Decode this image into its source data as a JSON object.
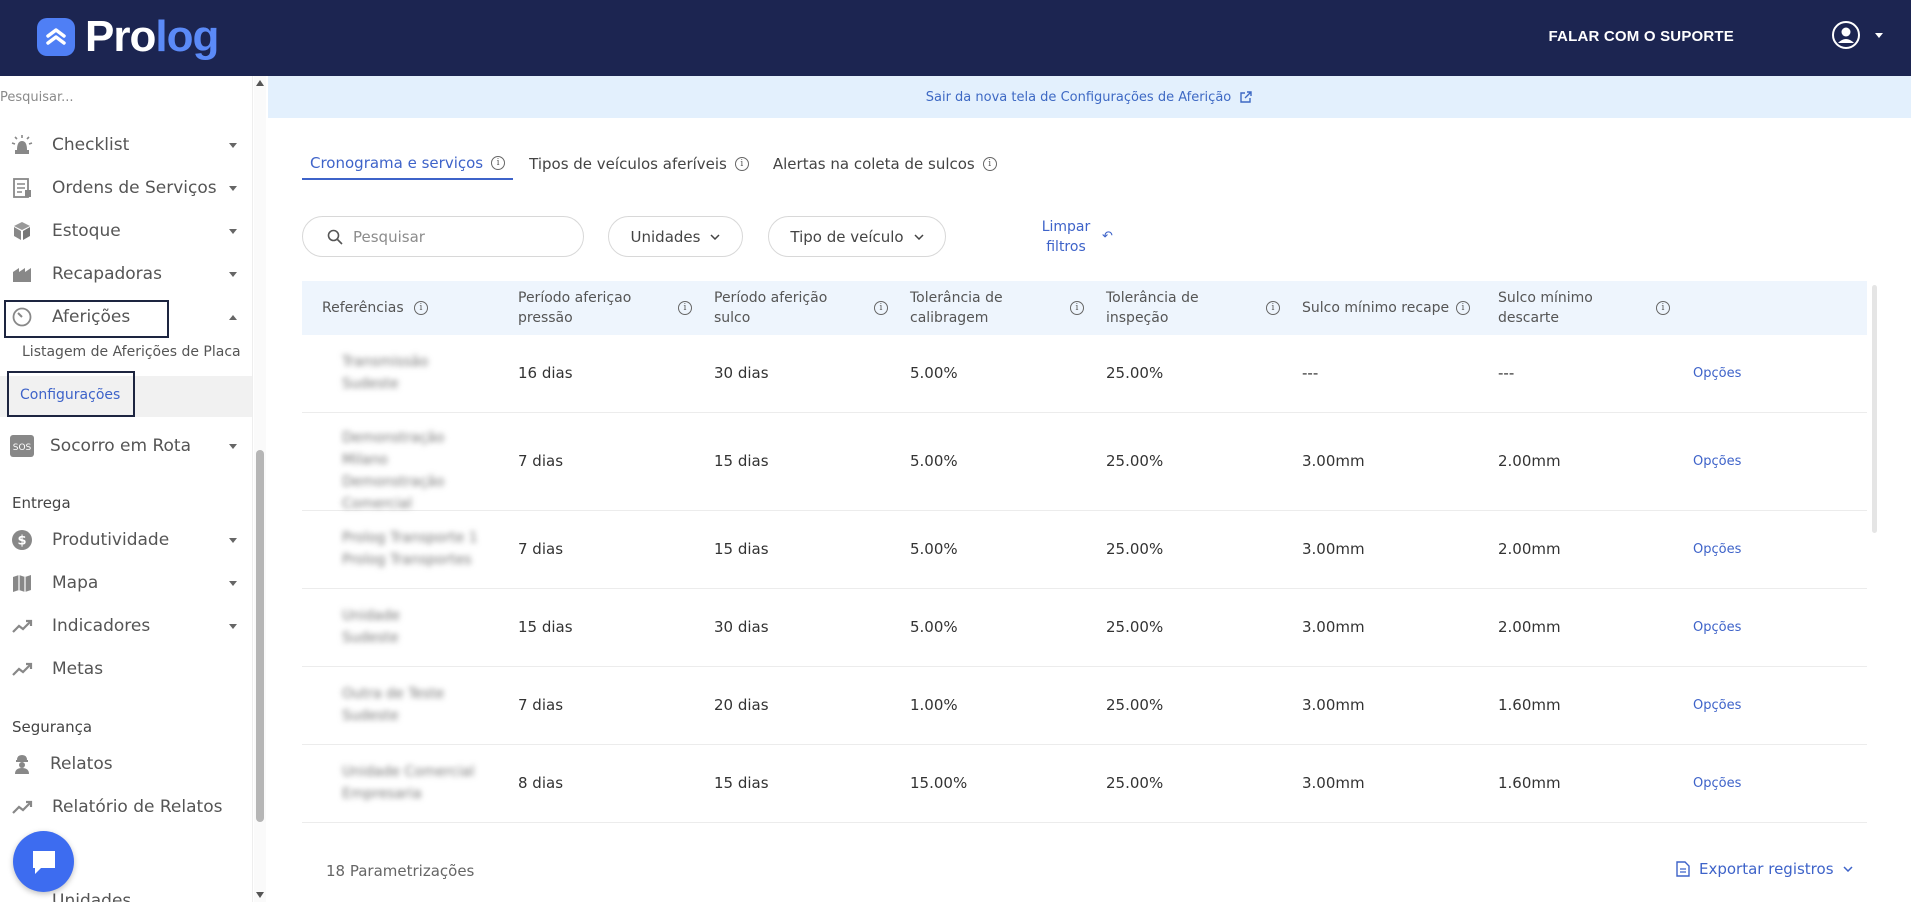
{
  "header": {
    "logo_left": "Pro",
    "logo_right": "log",
    "support_label": "FALAR COM O SUPORTE"
  },
  "sidebar": {
    "search_placeholder": "Pesquisar...",
    "items": [
      {
        "label": "Checklist",
        "icon": "alarm-light-icon"
      },
      {
        "label": "Ordens de Serviços",
        "icon": "document-list-icon"
      },
      {
        "label": "Estoque",
        "icon": "boxes-icon"
      },
      {
        "label": "Recapadoras",
        "icon": "factory-icon"
      },
      {
        "label": "Aferições",
        "icon": "gauge-icon"
      }
    ],
    "sub_items": [
      "Listagem de Aferições de Placa",
      "Configurações"
    ],
    "socorro_label": "Socorro em Rota",
    "section_entrega": "Entrega",
    "entrega_items": [
      "Produtividade",
      "Mapa",
      "Indicadores",
      "Metas"
    ],
    "section_seguranca": "Segurança",
    "seguranca_items": [
      "Relatos",
      "Relatório de Relatos"
    ],
    "partial_item": "Unidades"
  },
  "banner": {
    "text": "Sair da nova tela de Configurações de Aferição"
  },
  "tabs": [
    {
      "label": "Cronograma e serviços",
      "active": true
    },
    {
      "label": "Tipos de veículos aferíveis",
      "active": false
    },
    {
      "label": "Alertas na coleta de sulcos",
      "active": false
    }
  ],
  "filters": {
    "search_placeholder": "Pesquisar",
    "unidades": "Unidades",
    "tipo_veiculo": "Tipo de veículo",
    "limpar": "Limpar filtros"
  },
  "table": {
    "headers": [
      "Referências",
      "Período aferiçao pressão",
      "Período aferição sulco",
      "Tolerância de calibragem",
      "Tolerância de inspeção",
      "Sulco mínimo recape",
      "Sulco mínimo descarte"
    ],
    "rows": [
      {
        "ref": "Transmissão Sudeste",
        "pressao": "16 dias",
        "sulco": "30 dias",
        "calib": "5.00%",
        "insp": "25.00%",
        "recape": "---",
        "descarte": "---",
        "opt": "Opções"
      },
      {
        "ref": "Demonstração Milano Demonstração Comercial",
        "pressao": "7 dias",
        "sulco": "15 dias",
        "calib": "5.00%",
        "insp": "25.00%",
        "recape": "3.00mm",
        "descarte": "2.00mm",
        "opt": "Opções"
      },
      {
        "ref": "Prolog Transporte 1 Prolog Transportes",
        "pressao": "7 dias",
        "sulco": "15 dias",
        "calib": "5.00%",
        "insp": "25.00%",
        "recape": "3.00mm",
        "descarte": "2.00mm",
        "opt": "Opções"
      },
      {
        "ref": "Unidade Sudeste",
        "pressao": "15 dias",
        "sulco": "30 dias",
        "calib": "5.00%",
        "insp": "25.00%",
        "recape": "3.00mm",
        "descarte": "2.00mm",
        "opt": "Opções"
      },
      {
        "ref": "Outra de Teste Sudeste",
        "pressao": "7 dias",
        "sulco": "20 dias",
        "calib": "1.00%",
        "insp": "25.00%",
        "recape": "3.00mm",
        "descarte": "1.60mm",
        "opt": "Opções"
      },
      {
        "ref": "Unidade Comercial Empresaria",
        "pressao": "8 dias",
        "sulco": "15 dias",
        "calib": "15.00%",
        "insp": "25.00%",
        "recape": "3.00mm",
        "descarte": "1.60mm",
        "opt": "Opções"
      }
    ]
  },
  "footer": {
    "count": "18 Parametrizações",
    "export": "Exportar registros"
  },
  "colors": {
    "header_bg": "#1c2551",
    "accent": "#3e63c9",
    "banner_bg": "#e3f0fd",
    "table_header_bg": "#eef5fd"
  }
}
